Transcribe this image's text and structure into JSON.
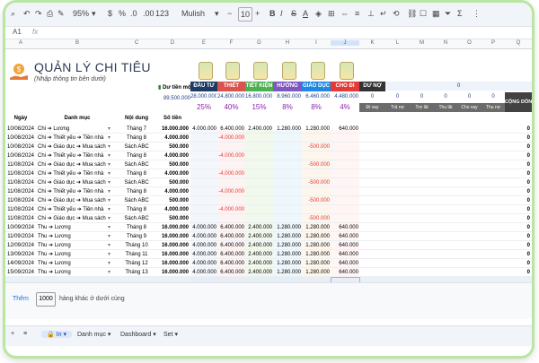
{
  "toolbar": {
    "zoom": "95%",
    "font": "Mulish",
    "font_size": "10",
    "percent": "%",
    "decimals": ".0",
    "decimals2": ".00",
    "num_format": "123"
  },
  "formula_bar": {
    "cell": "A1",
    "fx": "fx"
  },
  "columns": [
    "A",
    "B",
    "C",
    "D",
    "E",
    "F",
    "G",
    "H",
    "I",
    "J",
    "K",
    "L",
    "M",
    "N",
    "O",
    "P",
    "Q"
  ],
  "header": {
    "title": "QUẢN LÝ CHI TIÊU",
    "subtitle": "(Nhập thông tin bên dưới)",
    "du_tien_mot_label": "Dư tiền một",
    "du_tien_mot_value": "89.500.000",
    "categories": [
      {
        "label": "ĐẦU TƯ",
        "total": "28.000.000",
        "pct": "25%",
        "color": "#1f3b63"
      },
      {
        "label": "THIẾT YẾU",
        "total": "24.800.000",
        "pct": "40%",
        "color": "#d9534f"
      },
      {
        "label": "TIẾT KIỆM",
        "total": "16.800.000",
        "pct": "15%",
        "color": "#4caf50"
      },
      {
        "label": "HƯỞNG THỤ",
        "total": "8.960.000",
        "pct": "8%",
        "color": "#7e57c2"
      },
      {
        "label": "GIÁO DỤC",
        "total": "6.460.000",
        "pct": "8%",
        "color": "#1e88e5"
      },
      {
        "label": "CHO ĐI",
        "total": "4.480.000",
        "pct": "4%",
        "color": "#e53935"
      }
    ],
    "du_no_label": "DƯ NỢ",
    "du_no_value": "0",
    "debt_zeros": [
      "0",
      "0",
      "0",
      "0",
      "0",
      "0"
    ],
    "debt_cols": [
      "Đi vay",
      "Trả nợ",
      "Trợ lãi",
      "Thu lãi",
      "Cho vay",
      "Thu nợ"
    ],
    "cong_don": "CỘNG DỒN"
  },
  "table_header": {
    "date": "Ngày",
    "category": "Danh mục",
    "content": "Nội dung",
    "amount": "Số tiền"
  },
  "rows": [
    {
      "date": "10/08/2024",
      "cat": "Chi ➔ Lương",
      "content": "Tháng 7",
      "amount": "16.000.000",
      "e": "4.000.000",
      "f": "6.400.000",
      "g": "2.400.000",
      "h": "1.280.000",
      "i": "1.280.000",
      "j": "640.000",
      "q": "0"
    },
    {
      "date": "10/08/2024",
      "cat": "Chi ➔ Thiết yếu ➔ Tiền nhà",
      "content": "Tháng 8",
      "amount": "4.000.000",
      "e": "",
      "f": "-4.000.000",
      "g": "",
      "h": "",
      "i": "",
      "j": "",
      "q": "0"
    },
    {
      "date": "10/08/2024",
      "cat": "Chi ➔ Giáo dục ➔ Mua sách",
      "content": "Sách ABC",
      "amount": "500.000",
      "e": "",
      "f": "",
      "g": "",
      "h": "",
      "i": "-500.000",
      "j": "",
      "q": "0"
    },
    {
      "date": "10/08/2024",
      "cat": "Chi ➔ Thiết yếu ➔ Tiền nhà",
      "content": "Tháng 8",
      "amount": "4.000.000",
      "e": "",
      "f": "-4.000.000",
      "g": "",
      "h": "",
      "i": "",
      "j": "",
      "q": "0"
    },
    {
      "date": "11/08/2024",
      "cat": "Chi ➔ Giáo dục ➔ Mua sách",
      "content": "Sách ABC",
      "amount": "500.000",
      "e": "",
      "f": "",
      "g": "",
      "h": "",
      "i": "-500.000",
      "j": "",
      "q": "0"
    },
    {
      "date": "11/08/2024",
      "cat": "Chi ➔ Thiết yếu ➔ Tiền nhà",
      "content": "Tháng 8",
      "amount": "4.000.000",
      "e": "",
      "f": "-4.000.000",
      "g": "",
      "h": "",
      "i": "",
      "j": "",
      "q": "0"
    },
    {
      "date": "11/08/2024",
      "cat": "Chi ➔ Giáo dục ➔ Mua sách",
      "content": "Sách ABC",
      "amount": "500.000",
      "e": "",
      "f": "",
      "g": "",
      "h": "",
      "i": "-500.000",
      "j": "",
      "q": "0"
    },
    {
      "date": "11/08/2024",
      "cat": "Chi ➔ Thiết yếu ➔ Tiền nhà",
      "content": "Tháng 8",
      "amount": "4.000.000",
      "e": "",
      "f": "-4.000.000",
      "g": "",
      "h": "",
      "i": "",
      "j": "",
      "q": "0"
    },
    {
      "date": "11/08/2024",
      "cat": "Chi ➔ Giáo dục ➔ Mua sách",
      "content": "Sách ABC",
      "amount": "500.000",
      "e": "",
      "f": "",
      "g": "",
      "h": "",
      "i": "-500.000",
      "j": "",
      "q": "0"
    },
    {
      "date": "11/08/2024",
      "cat": "Chi ➔ Thiết yếu ➔ Tiền nhà",
      "content": "Tháng 8",
      "amount": "4.000.000",
      "e": "",
      "f": "-4.000.000",
      "g": "",
      "h": "",
      "i": "",
      "j": "",
      "q": "0"
    },
    {
      "date": "11/08/2024",
      "cat": "Chi ➔ Giáo dục ➔ Mua sách",
      "content": "Sách ABC",
      "amount": "500.000",
      "e": "",
      "f": "",
      "g": "",
      "h": "",
      "i": "-500.000",
      "j": "",
      "q": "0"
    },
    {
      "date": "10/09/2024",
      "cat": "Thu ➔ Lương",
      "content": "Tháng 8",
      "amount": "16.000.000",
      "e": "4.000.000",
      "f": "6.400.000",
      "g": "2.400.000",
      "h": "1.280.000",
      "i": "1.280.000",
      "j": "640.000",
      "q": "0"
    },
    {
      "date": "11/09/2024",
      "cat": "Thu ➔ Lương",
      "content": "Tháng 9",
      "amount": "16.000.000",
      "e": "4.000.000",
      "f": "6.400.000",
      "g": "2.400.000",
      "h": "1.280.000",
      "i": "1.280.000",
      "j": "640.000",
      "q": "0"
    },
    {
      "date": "12/09/2024",
      "cat": "Thu ➔ Lương",
      "content": "Tháng 10",
      "amount": "16.000.000",
      "e": "4.000.000",
      "f": "6.400.000",
      "g": "2.400.000",
      "h": "1.280.000",
      "i": "1.280.000",
      "j": "640.000",
      "q": "0"
    },
    {
      "date": "13/09/2024",
      "cat": "Thu ➔ Lương",
      "content": "Tháng 11",
      "amount": "16.000.000",
      "e": "4.000.000",
      "f": "6.400.000",
      "g": "2.400.000",
      "h": "1.280.000",
      "i": "1.280.000",
      "j": "640.000",
      "q": "0"
    },
    {
      "date": "14/09/2024",
      "cat": "Thu ➔ Lương",
      "content": "Tháng 12",
      "amount": "16.000.000",
      "e": "4.000.000",
      "f": "6.400.000",
      "g": "2.400.000",
      "h": "1.280.000",
      "i": "1.280.000",
      "j": "640.000",
      "q": "0"
    },
    {
      "date": "15/09/2024",
      "cat": "Thu ➔ Lương",
      "content": "Tháng 13",
      "amount": "16.000.000",
      "e": "4.000.000",
      "f": "6.400.000",
      "g": "2.400.000",
      "h": "1.280.000",
      "i": "1.280.000",
      "j": "640.000",
      "q": "0"
    }
  ],
  "bottom": {
    "add_label": "Thêm",
    "add_count": "1000",
    "add_suffix": "hàng khác ở dưới cùng"
  },
  "sheets": [
    {
      "label": "In",
      "active": true
    },
    {
      "label": "Danh mục",
      "active": false
    },
    {
      "label": "Dashboard",
      "active": false
    },
    {
      "label": "Set",
      "active": false
    }
  ]
}
